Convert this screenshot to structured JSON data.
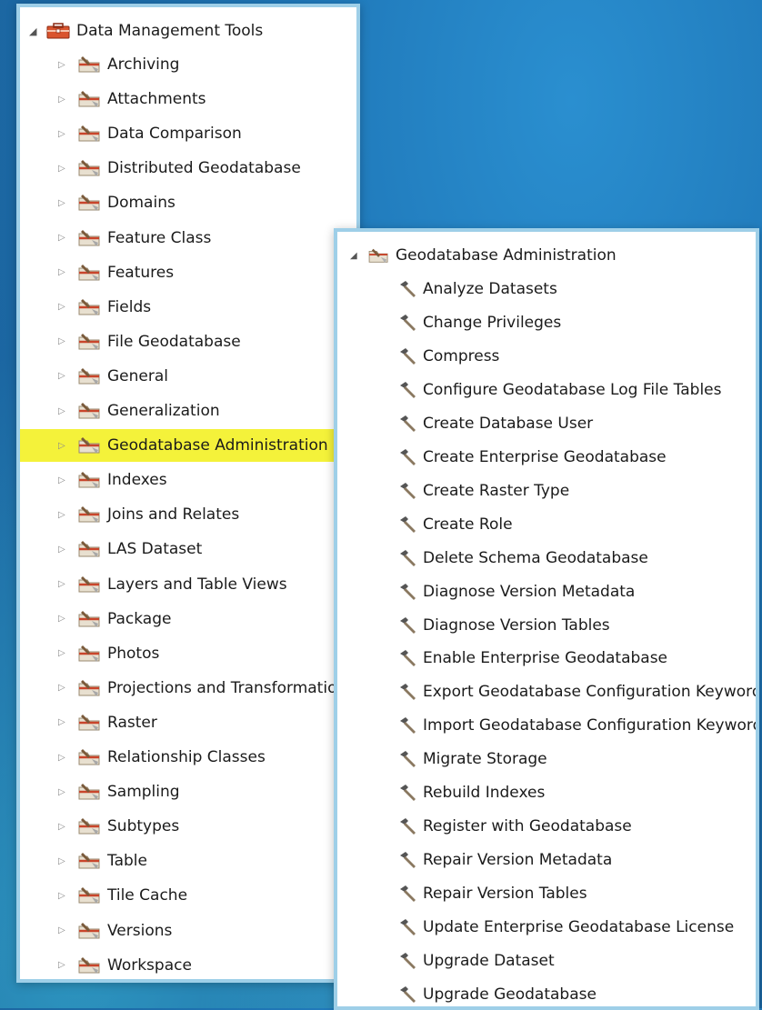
{
  "left_panel": {
    "root_label": "Data Management Tools",
    "items": [
      {
        "label": "Archiving"
      },
      {
        "label": "Attachments"
      },
      {
        "label": "Data Comparison"
      },
      {
        "label": "Distributed Geodatabase"
      },
      {
        "label": "Domains"
      },
      {
        "label": "Feature Class"
      },
      {
        "label": "Features"
      },
      {
        "label": "Fields"
      },
      {
        "label": "File Geodatabase"
      },
      {
        "label": "General"
      },
      {
        "label": "Generalization"
      },
      {
        "label": "Geodatabase Administration",
        "highlighted": true
      },
      {
        "label": "Indexes"
      },
      {
        "label": "Joins and Relates"
      },
      {
        "label": "LAS Dataset"
      },
      {
        "label": "Layers and Table Views"
      },
      {
        "label": "Package"
      },
      {
        "label": "Photos"
      },
      {
        "label": "Projections and Transformations"
      },
      {
        "label": "Raster"
      },
      {
        "label": "Relationship Classes"
      },
      {
        "label": "Sampling"
      },
      {
        "label": "Subtypes"
      },
      {
        "label": "Table"
      },
      {
        "label": "Tile Cache"
      },
      {
        "label": "Versions"
      },
      {
        "label": "Workspace"
      }
    ]
  },
  "right_panel": {
    "root_label": "Geodatabase Administration",
    "tools": [
      {
        "label": "Analyze Datasets"
      },
      {
        "label": "Change Privileges"
      },
      {
        "label": "Compress"
      },
      {
        "label": "Configure Geodatabase Log File Tables"
      },
      {
        "label": "Create Database User"
      },
      {
        "label": "Create Enterprise Geodatabase"
      },
      {
        "label": "Create Raster Type"
      },
      {
        "label": "Create Role"
      },
      {
        "label": "Delete Schema Geodatabase"
      },
      {
        "label": "Diagnose Version Metadata"
      },
      {
        "label": "Diagnose Version Tables"
      },
      {
        "label": "Enable Enterprise Geodatabase"
      },
      {
        "label": "Export Geodatabase Configuration Keywords"
      },
      {
        "label": "Import Geodatabase Configuration Keywords"
      },
      {
        "label": "Migrate Storage"
      },
      {
        "label": "Rebuild Indexes"
      },
      {
        "label": "Register with Geodatabase"
      },
      {
        "label": "Repair Version Metadata"
      },
      {
        "label": "Repair Version Tables"
      },
      {
        "label": "Update Enterprise Geodatabase License"
      },
      {
        "label": "Upgrade Dataset"
      },
      {
        "label": "Upgrade Geodatabase"
      }
    ]
  },
  "colors": {
    "highlight": "#f4f23a",
    "panel_border": "#9ecfe8",
    "toolbox_red": "#c9452b"
  },
  "icons": {
    "root": "toolbox-icon",
    "toolset": "toolset-icon",
    "tool": "hammer-icon",
    "collapsed": "expand-arrow-icon",
    "expanded": "collapse-arrow-icon"
  }
}
